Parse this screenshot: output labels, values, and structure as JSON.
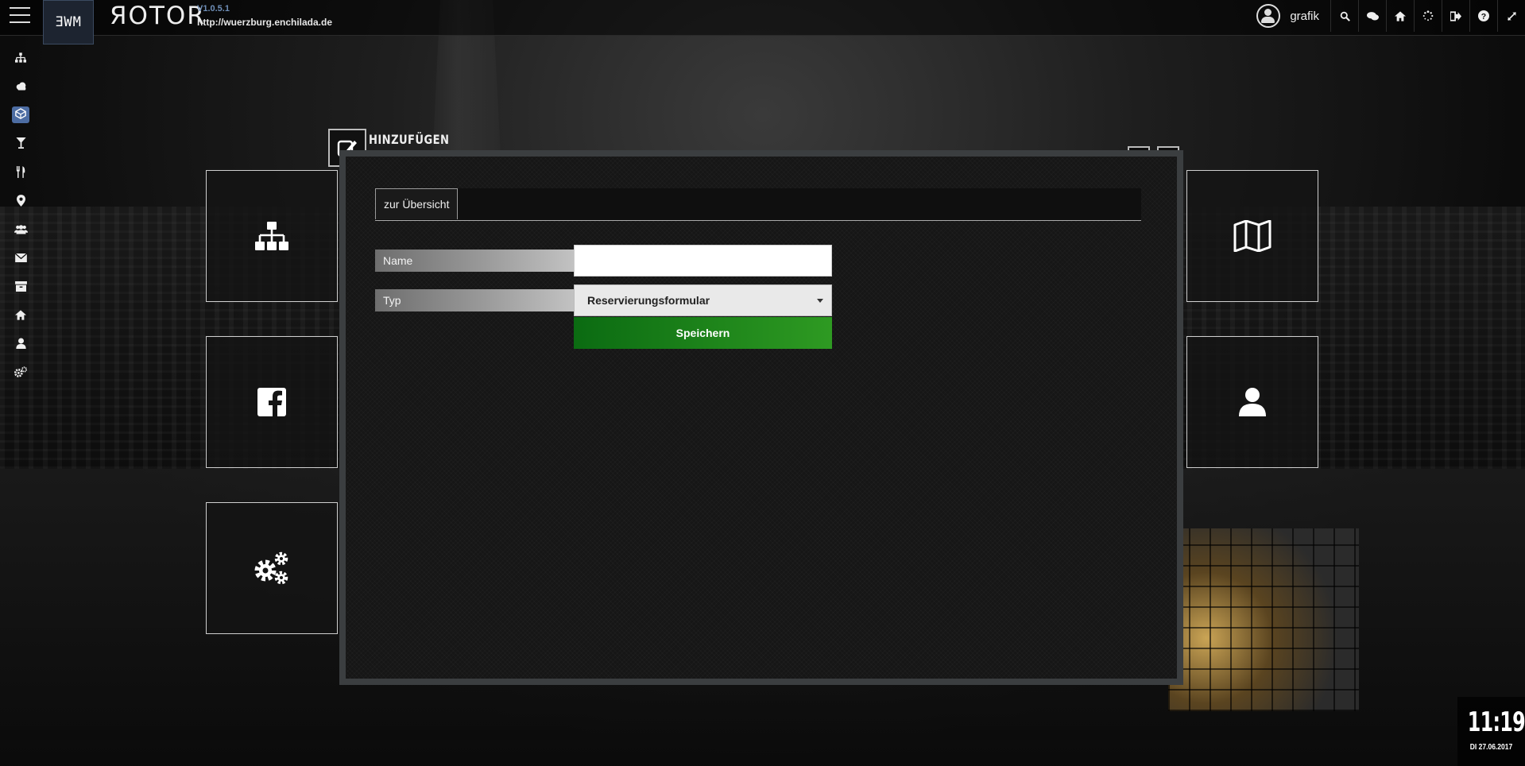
{
  "header": {
    "brand_box": "ƎWM",
    "app_name": "ЯOTOR",
    "version": "V1.0.5.1",
    "url": "http://wuerzburg.enchilada.de",
    "username": "grafik",
    "icons": [
      "search-icon",
      "chat-icon",
      "home-icon",
      "spinner-icon",
      "logout-icon",
      "help-icon",
      "expand-icon"
    ]
  },
  "sidebar": {
    "items": [
      {
        "icon": "sitemap-icon",
        "glyph": "⊶"
      },
      {
        "icon": "cloud-icon",
        "glyph": "☁"
      },
      {
        "icon": "cube-icon",
        "glyph": "⬢",
        "active": true
      },
      {
        "icon": "cocktail-icon",
        "glyph": "🍸"
      },
      {
        "icon": "cutlery-icon",
        "glyph": "🍴"
      },
      {
        "icon": "map-marker-icon",
        "glyph": "📍"
      },
      {
        "icon": "users-icon",
        "glyph": "👥"
      },
      {
        "icon": "envelope-icon",
        "glyph": "✉"
      },
      {
        "icon": "archive-icon",
        "glyph": "▤"
      },
      {
        "icon": "home-icon",
        "glyph": "⌂"
      },
      {
        "icon": "user-icon",
        "glyph": "👤"
      },
      {
        "icon": "cogs-icon",
        "glyph": "⚙"
      }
    ]
  },
  "tiles": {
    "left": [
      "sitemap-icon",
      "facebook-icon",
      "cogs-icon"
    ],
    "right": [
      "map-icon",
      "user-icon"
    ]
  },
  "modal": {
    "title": "HINZUFÜGEN",
    "tab_label": "zur Übersicht",
    "name_label": "Name",
    "name_value": "",
    "type_label": "Typ",
    "type_value": "Reservierungsformular",
    "save_label": "Speichern"
  },
  "clock": {
    "time": "11:19",
    "date": "DI 27.06.2017"
  },
  "colors": {
    "accent": "#4d6da3",
    "save_green": "#2e9a22",
    "version_blue": "#6f8fb8"
  }
}
